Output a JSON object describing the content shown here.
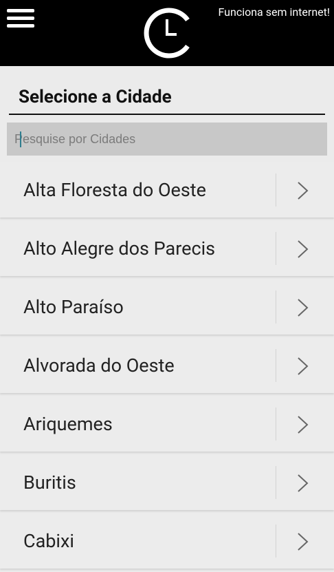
{
  "header": {
    "offline_text": "Funciona sem internet!"
  },
  "page": {
    "title": "Selecione a Cidade"
  },
  "search": {
    "placeholder": "Pesquise por Cidades",
    "value": ""
  },
  "cities": [
    {
      "name": "Alta Floresta do Oeste"
    },
    {
      "name": "Alto Alegre dos Parecis"
    },
    {
      "name": "Alto Paraíso"
    },
    {
      "name": "Alvorada do Oeste"
    },
    {
      "name": "Ariquemes"
    },
    {
      "name": "Buritis"
    },
    {
      "name": "Cabixi"
    }
  ],
  "colors": {
    "header_bg": "#000000",
    "page_bg": "#ebebeb",
    "search_bg": "#c8c8c8",
    "caret": "#2f7d8e"
  },
  "icons": {
    "menu": "hamburger-icon",
    "logo": "clock-logo-icon",
    "row_arrow": "chevron-right-icon"
  }
}
